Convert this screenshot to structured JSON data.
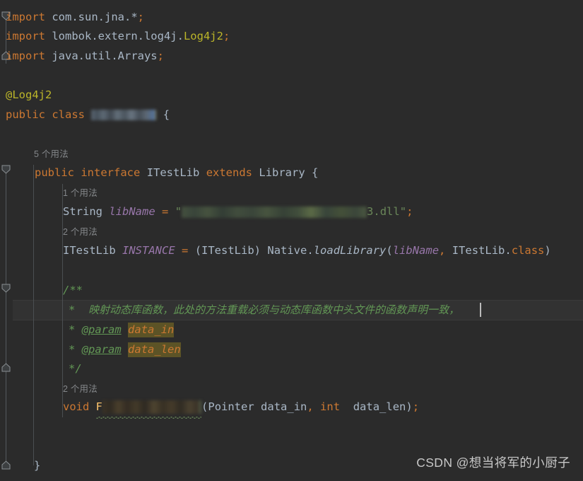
{
  "editor": {
    "background": "#2b2b2b",
    "foreground": "#a9b7c6",
    "current_line_background": "#323232",
    "gutter_background": "#313335",
    "caret_color": "#bbbbbb"
  },
  "code": {
    "line1": {
      "kw": "import",
      "rest": " com.sun.jna.",
      "star": "*",
      "semi": ";"
    },
    "line2": {
      "kw": "import",
      "pkg": " lombok.extern.log4j.",
      "cls": "Log4j2",
      "semi": ";"
    },
    "line3": {
      "kw": "import",
      "rest": " java.util.Arrays",
      "semi": ";"
    },
    "line5": {
      "annotation": "@Log4j2"
    },
    "line6": {
      "kw1": "public",
      "kw2": "class",
      "class_name": "[redacted]",
      "brace": "{"
    },
    "line8_usage": "5 个用法",
    "line9": {
      "kw1": "public",
      "kw2": "interface",
      "name": "ITestLib",
      "kw3": "extends",
      "super": "Library",
      "brace": "{"
    },
    "line10_usage": "1 个用法",
    "line11": {
      "type": "String",
      "field": "libName",
      "eq": "=",
      "quote_open": "\"",
      "value_redacted": "[redacted]",
      "value_tail": "3.dll",
      "quote_close": "\"",
      "semi": ";"
    },
    "line12_usage": "2 个用法",
    "line13": {
      "type": "ITestLib",
      "field": "INSTANCE",
      "eq": "=",
      "cast": "(ITestLib)",
      "owner": "Native",
      "dot": ".",
      "method": "loadLibrary",
      "paren_open": "(",
      "arg1": "libName",
      "comma": ",",
      "arg2": "ITestLib",
      "dot2": ".",
      "kw_class": "class",
      "paren_close": ")"
    },
    "line15_comment_open": "/**",
    "line16_comment": {
      "star": "*",
      "text": "映射动态库函数，此处的方法重载必须与动态库函数中头文件的函数声明一致，"
    },
    "line17_comment": {
      "star": "*",
      "tag": "@param",
      "value": "data_in"
    },
    "line18_comment": {
      "star": "*",
      "tag": "@param",
      "value": "data_len"
    },
    "line19_comment_close": "*/",
    "line20_usage": "2 个用法",
    "line21": {
      "ret": "void",
      "name_prefix": "F",
      "name_redacted": "[redacted]",
      "paren_open": "(",
      "ptype1": "Pointer",
      "pname1": "data_in",
      "comma": ",",
      "ptype2": "int",
      "pname2": "data_len",
      "paren_close": ")",
      "semi": ";"
    },
    "line24": {
      "brace": "}"
    }
  },
  "watermark": {
    "text": "CSDN @想当将军的小厨子"
  },
  "colors": {
    "keyword": "#cc7832",
    "string": "#6a8759",
    "annotation": "#bbb529",
    "field_italic": "#9876aa",
    "comment": "#629755",
    "plain": "#a9b7c6",
    "inlay_hint": "#84878a",
    "param_highlight_bg": "#5c5326"
  }
}
